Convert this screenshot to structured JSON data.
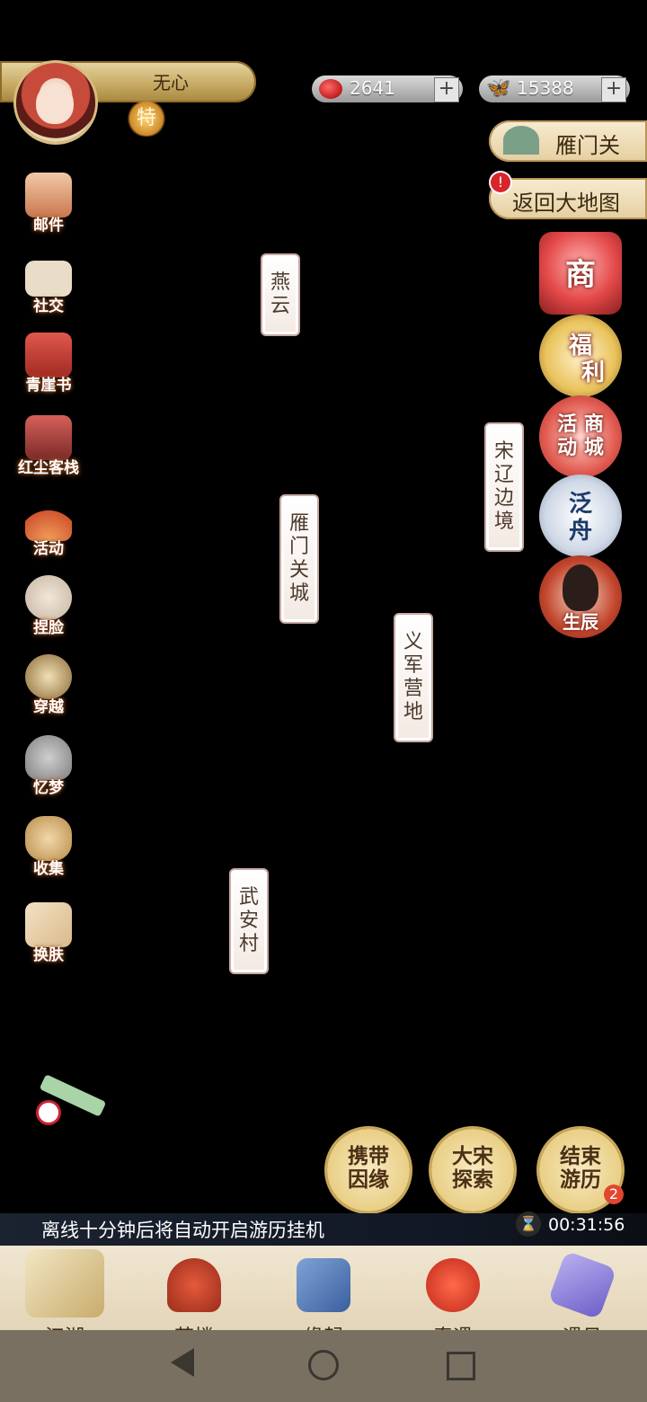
{
  "player": {
    "name": "无心",
    "badge": "特"
  },
  "currency": [
    {
      "icon": "red-bean-icon",
      "value": "2641",
      "plus": "+"
    },
    {
      "icon": "butterfly-icon",
      "value": "15388",
      "plus": "+"
    }
  ],
  "location_title": "雁门关",
  "back_to_map": "返回大地图",
  "alert": "!",
  "left_menu": [
    "邮件",
    "社交",
    "青崖书",
    "红尘客栈",
    "活动",
    "捏脸",
    "穿越",
    "忆梦",
    "收集",
    "换肤"
  ],
  "map_locations": [
    {
      "chars": [
        "燕",
        "云"
      ]
    },
    {
      "chars": [
        "雁",
        "门",
        "关",
        "城"
      ]
    },
    {
      "chars": [
        "宋",
        "辽",
        "边",
        "境"
      ]
    },
    {
      "chars": [
        "义",
        "军",
        "营",
        "地"
      ]
    },
    {
      "chars": [
        "武",
        "安",
        "村"
      ]
    }
  ],
  "right_buttons": {
    "shop": "商",
    "welfare": [
      "福",
      "利"
    ],
    "event_mall": [
      "活",
      "商",
      "动",
      "城"
    ],
    "boat": [
      "泛",
      "舟"
    ],
    "birthday": "生辰"
  },
  "actions": [
    {
      "lines": [
        "携带",
        "因缘"
      ]
    },
    {
      "lines": [
        "大宋",
        "探索"
      ]
    },
    {
      "lines": [
        "结束",
        "游历"
      ],
      "badge": "2"
    }
  ],
  "notice": "离线十分钟后将自动开启游历挂机",
  "timer": "00:31:56",
  "bottom_nav": [
    "江湖",
    "茶楼",
    "缘起",
    "奇遇",
    "遇见"
  ],
  "colors": {
    "gold": "#c5a760",
    "notice_bg": "#1b2230",
    "nav_bg": "#f0e6d1"
  }
}
